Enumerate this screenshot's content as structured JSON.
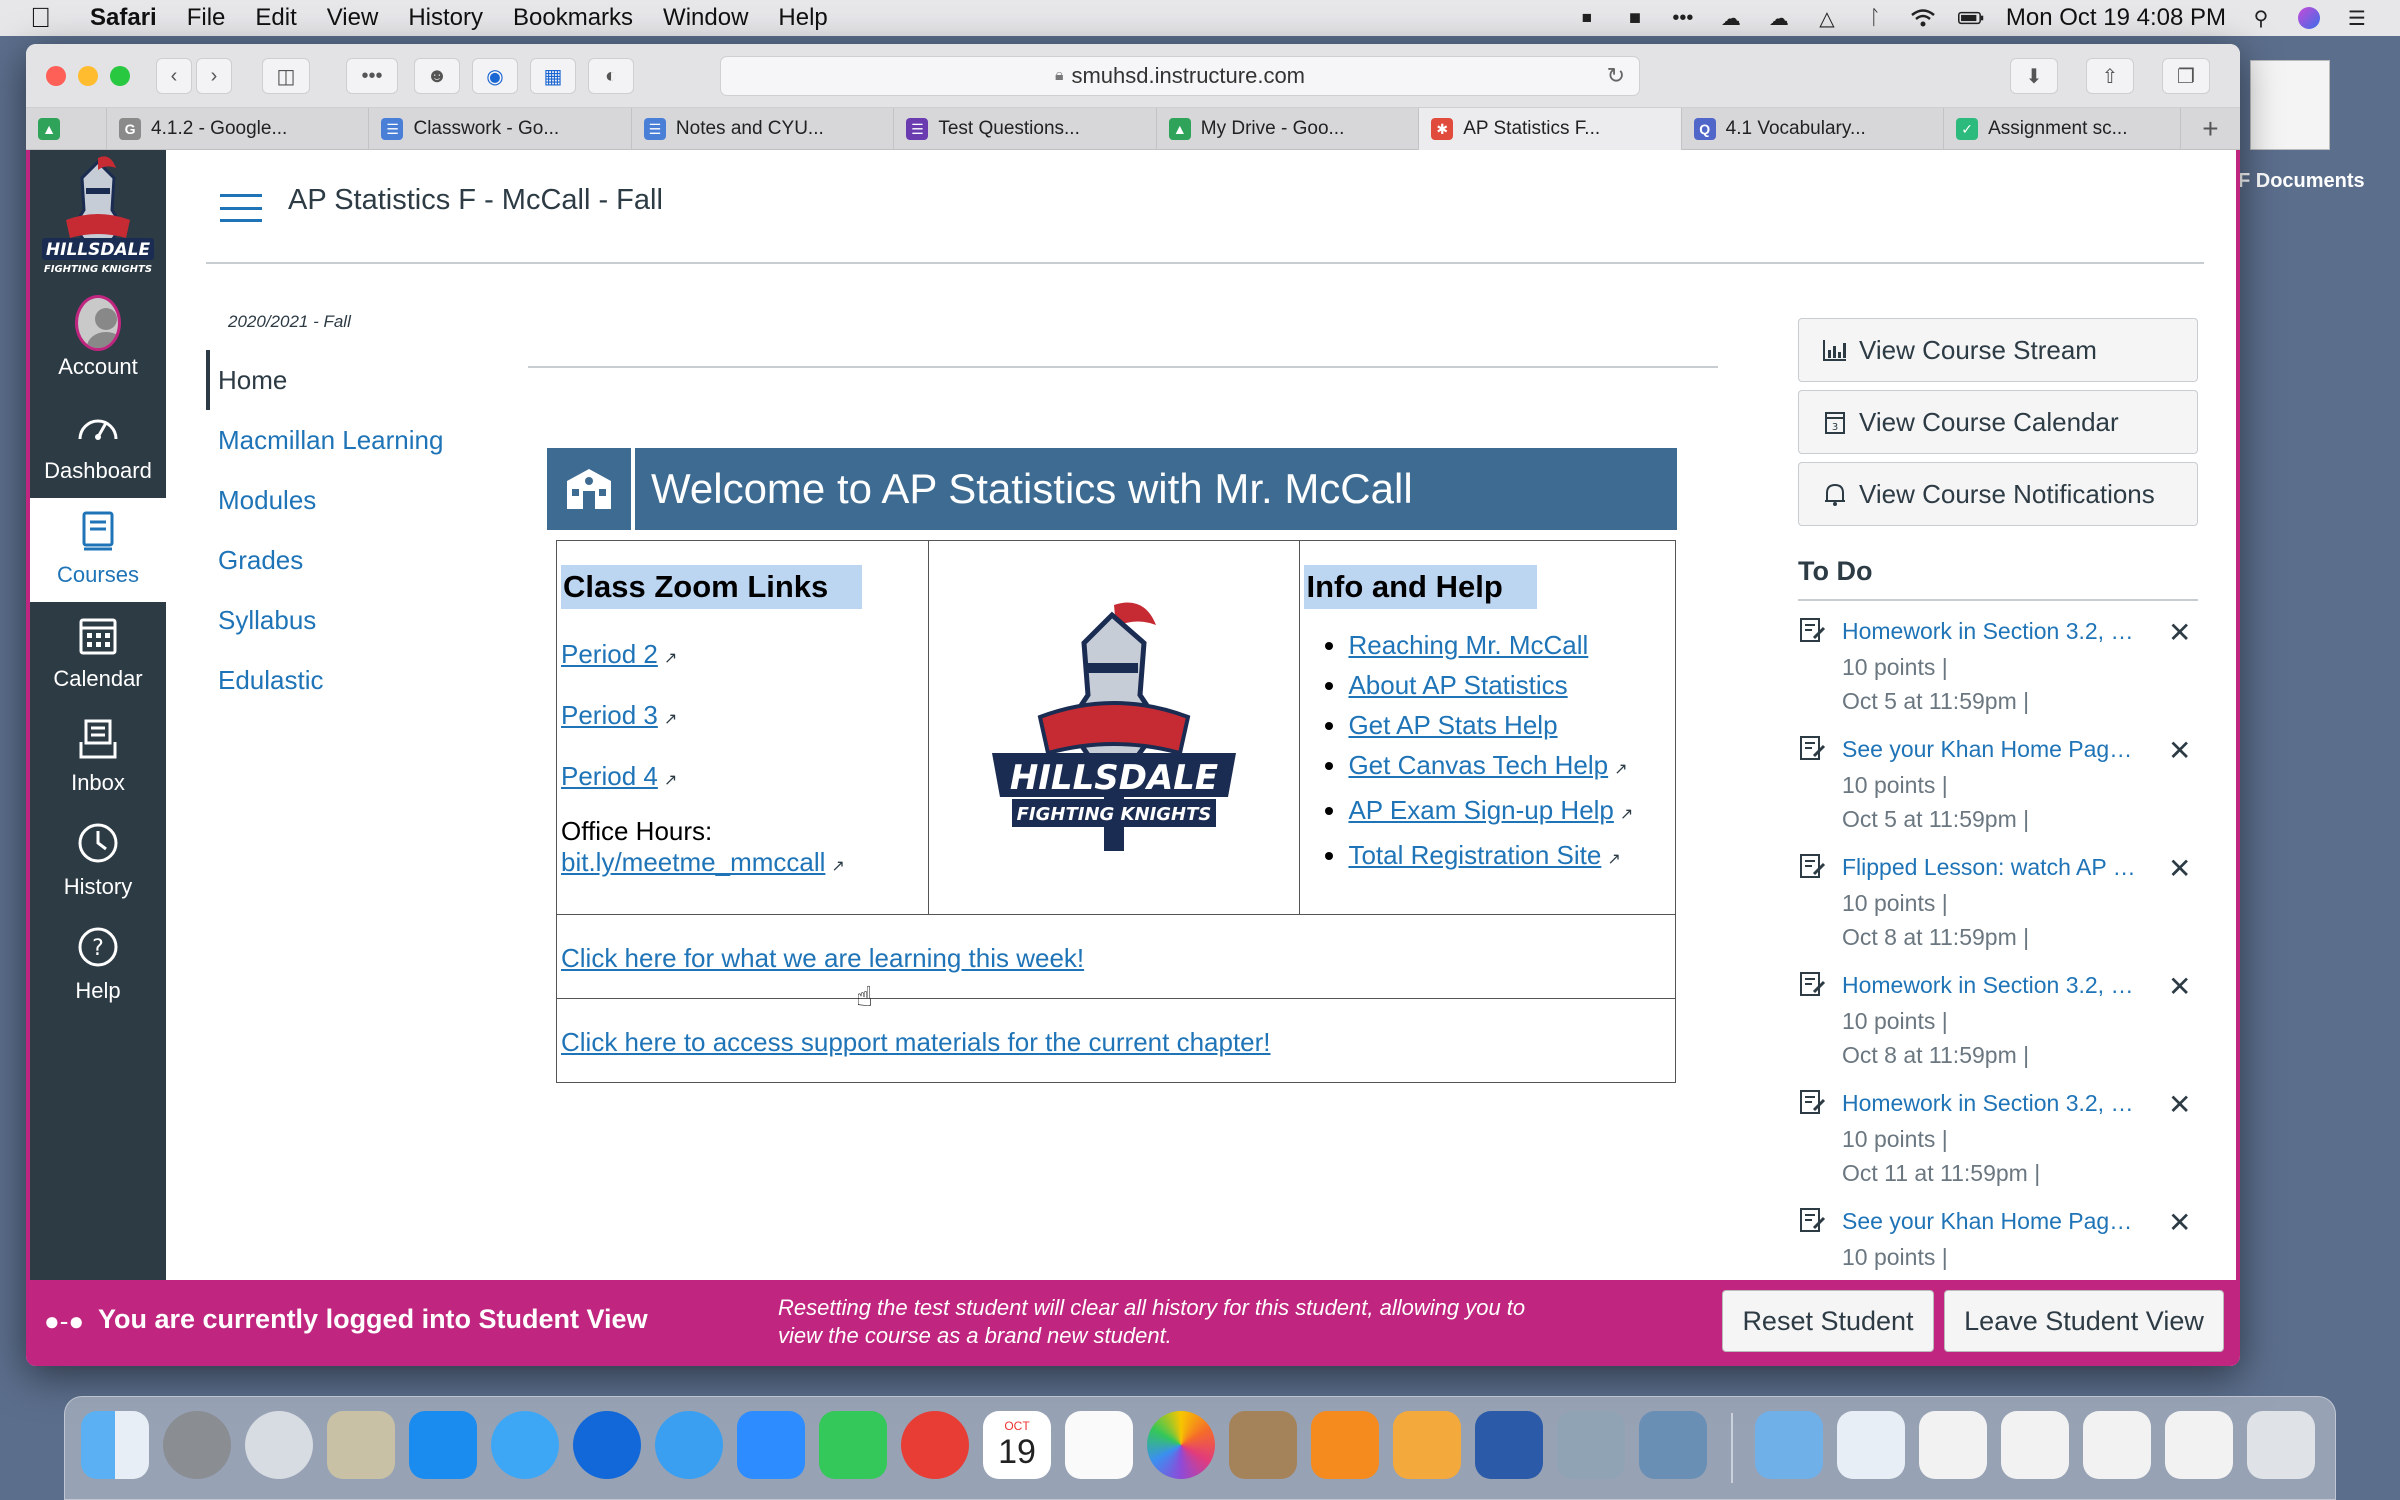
{
  "menubar": {
    "app_name": "Safari",
    "menus": [
      "File",
      "Edit",
      "View",
      "History",
      "Bookmarks",
      "Window",
      "Help"
    ],
    "datetime": "Mon Oct 19  4:08 PM"
  },
  "desktop": {
    "doc_label": "F Documents"
  },
  "browser": {
    "url": "smuhsd.instructure.com",
    "tabs": [
      {
        "label": "",
        "color": "#2fa35a"
      },
      {
        "label": "4.1.2 - Google...",
        "color": "#8a8a8a"
      },
      {
        "label": "Classwork - Go...",
        "color": "#4a7fd8"
      },
      {
        "label": "Notes and CYU...",
        "color": "#4a7fd8"
      },
      {
        "label": "Test Questions...",
        "color": "#6a3cb0"
      },
      {
        "label": "My Drive - Goo...",
        "color": "#2fa35a"
      },
      {
        "label": "AP Statistics F...",
        "color": "#e14b3b"
      },
      {
        "label": "4.1 Vocabulary...",
        "color": "#5066c9"
      },
      {
        "label": "Assignment sc...",
        "color": "#2dbb7d"
      }
    ]
  },
  "global_nav": {
    "items": [
      {
        "label": "Account"
      },
      {
        "label": "Dashboard"
      },
      {
        "label": "Courses"
      },
      {
        "label": "Calendar"
      },
      {
        "label": "Inbox"
      },
      {
        "label": "History"
      },
      {
        "label": "Help"
      }
    ]
  },
  "header": {
    "breadcrumb": "AP Statistics F - McCall - Fall"
  },
  "course_nav": {
    "term": "2020/2021 - Fall",
    "items": [
      "Home",
      "Macmillan Learning",
      "Modules",
      "Grades",
      "Syllabus",
      "Edulastic"
    ]
  },
  "main": {
    "banner_title": "Welcome to AP Statistics with Mr. McCall",
    "zoom_heading": "Class Zoom Links",
    "zoom_links": [
      "Period 2",
      "Period 3",
      "Period 4"
    ],
    "office_hours_label": "Office Hours:",
    "office_hours_link": "bit.ly/meetme_mmccall",
    "logo_text_top": "HILLSDALE",
    "logo_text_bottom": "FIGHTING KNIGHTS",
    "info_heading": "Info and Help",
    "info_links": [
      "Reaching Mr. McCall",
      "About AP Statistics",
      "Get AP Stats Help",
      "Get Canvas Tech Help",
      "AP Exam Sign-up Help",
      "Total Registration Site"
    ],
    "learning_link": "Click here for what we are learning this week!",
    "support_link": "Click here to access support materials for the current chapter!"
  },
  "sidebar": {
    "buttons": [
      "View Course Stream",
      "View Course Calendar",
      "View Course Notifications"
    ],
    "todo_heading": "To Do",
    "todos": [
      {
        "title": "Homework in Section 3.2, p...",
        "points": "10 points  |",
        "due": "Oct 5 at 11:59pm  |"
      },
      {
        "title": "See your Khan Home Page ...",
        "points": "10 points  |",
        "due": "Oct 5 at 11:59pm  |"
      },
      {
        "title": "Flipped Lesson: watch AP C...",
        "points": "10 points  |",
        "due": "Oct 8 at 11:59pm  |"
      },
      {
        "title": "Homework in Section 3.2, p...",
        "points": "10 points  |",
        "due": "Oct 8 at 11:59pm  |"
      },
      {
        "title": "Homework in Section 3.2, p...",
        "points": "10 points  |",
        "due": "Oct 11 at 11:59pm  |"
      },
      {
        "title": "See your Khan Home Page ...",
        "points": "10 points  |",
        "due": ""
      }
    ]
  },
  "student_view": {
    "message": "You are currently logged into Student View",
    "note": "Resetting the test student will clear all history for this student, allowing you to view the course as a brand new student.",
    "reset_label": "Reset Student",
    "leave_label": "Leave Student View"
  },
  "dock": {
    "calendar_month": "OCT",
    "calendar_day": "19",
    "apps": [
      "finder-icon",
      "system-preferences-icon",
      "launchpad-icon",
      "calculator-icon",
      "app-store-icon",
      "messages-icon",
      "navigation-icon",
      "safari-icon",
      "zoom-icon",
      "facetime-icon",
      "mail-icon",
      "calendar-icon",
      "reminders-icon",
      "photos-icon",
      "contacts-icon",
      "books-icon",
      "pages-icon",
      "word-icon",
      "numbers-icon",
      "preview-icon"
    ]
  },
  "colors": {
    "canvas_nav": "#2d3b45",
    "link": "#1f74b7",
    "student_view": "#c0267f",
    "banner": "#3e6b91"
  }
}
